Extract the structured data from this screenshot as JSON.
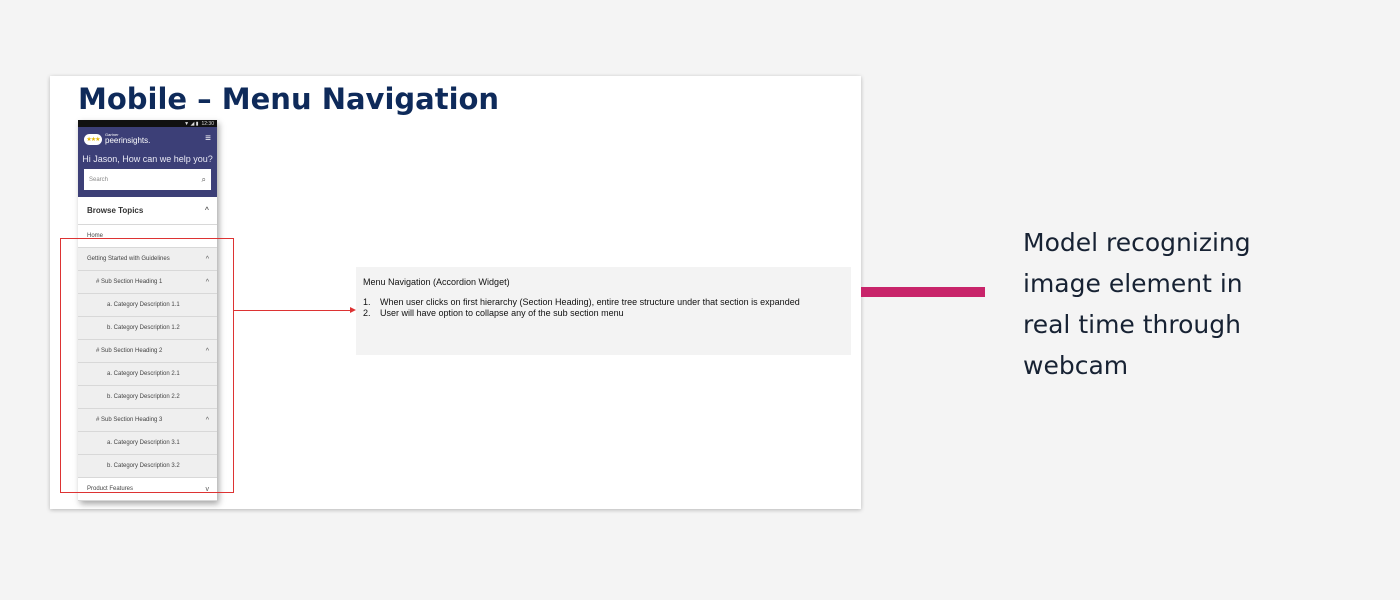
{
  "slide": {
    "title": "Mobile – Menu Navigation"
  },
  "phone": {
    "status_time": "12:30",
    "status_icons": "▼ ◢ ▮",
    "logo": {
      "badge": "★★★",
      "brand": "Gartner",
      "name": "peerinsights."
    },
    "menu_icon": "hamburger-icon",
    "greeting": "Hi Jason, How can we help you?",
    "search": {
      "placeholder": "Search",
      "icon": "search-icon"
    },
    "menu": {
      "browse_topics": "Browse Topics",
      "home": "Home",
      "getting_started": "Getting Started with Guidelines",
      "sub1": "# Sub Section Heading 1",
      "cat11": "a. Category Description 1.1",
      "cat12": "b. Category Description 1.2",
      "sub2": "# Sub Section Heading 2",
      "cat21": "a. Category Description 2.1",
      "cat22": "b. Category Description 2.2",
      "sub3": "# Sub Section Heading 3",
      "cat31": "a. Category Description 3.1",
      "cat32": "b. Category Description 3.2",
      "product_features": "Product Features"
    },
    "chevron_up": "^",
    "chevron_down": "v"
  },
  "annotation": {
    "title": "Menu Navigation (Accordion Widget)",
    "items": [
      {
        "num": "1.",
        "text": "When user clicks on first hierarchy (Section Heading), entire tree structure under that section is expanded"
      },
      {
        "num": "2.",
        "text": "User will have option to collapse any of the sub section menu"
      }
    ]
  },
  "caption": "Model recognizing\nimage element in\nreal time through\nwebcam",
  "colors": {
    "title": "#0e2a5a",
    "app_header": "#3c3f77",
    "highlight": "#dd3333",
    "accent_bar": "#c8246a"
  }
}
